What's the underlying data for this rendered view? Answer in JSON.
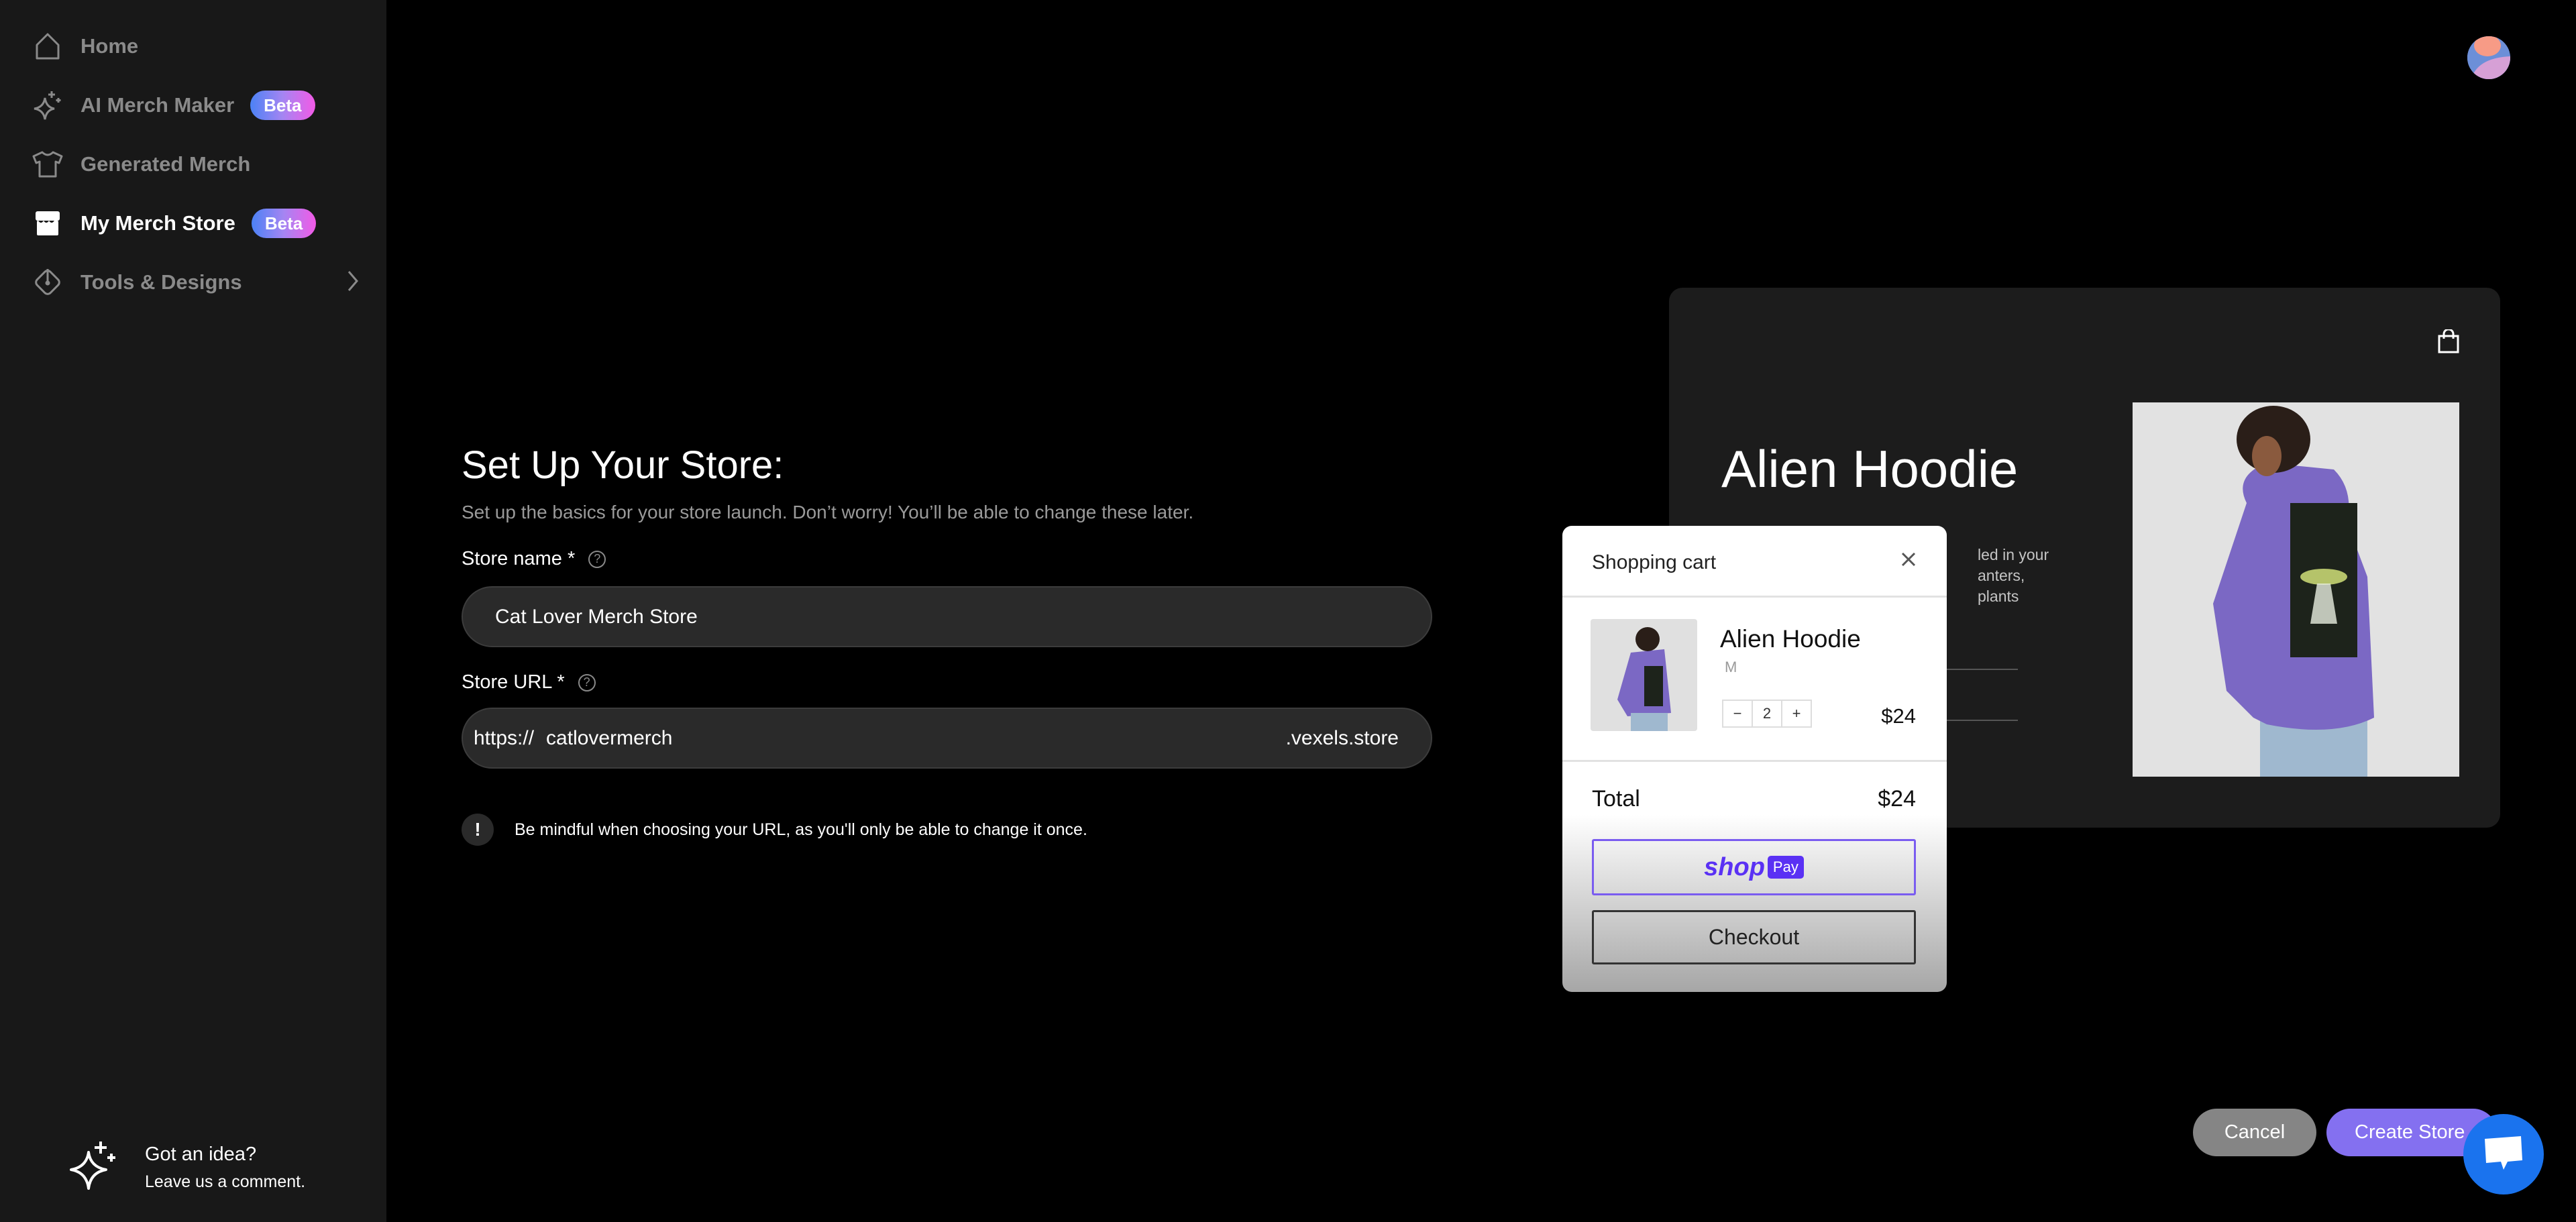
{
  "sidebar": {
    "items": [
      {
        "label": "Home",
        "icon": "home-icon"
      },
      {
        "label": "AI Merch Maker",
        "icon": "sparkle-icon",
        "badge": "Beta"
      },
      {
        "label": "Generated Merch",
        "icon": "tshirt-icon"
      },
      {
        "label": "My Merch Store",
        "icon": "store-icon",
        "badge": "Beta",
        "active": true
      },
      {
        "label": "Tools & Designs",
        "icon": "pen-tool-icon",
        "has_submenu": true
      }
    ],
    "feedback": {
      "title": "Got an idea?",
      "subtitle": "Leave us a comment."
    }
  },
  "form": {
    "title": "Set Up Your Store:",
    "subtitle": "Set up the basics for your store launch. Don’t worry! You’ll be able to change these later.",
    "store_name_label": "Store name *",
    "store_name_value": "Cat Lover Merch Store",
    "store_url_label": "Store URL *",
    "url_prefix": "https://",
    "url_value": "catlovermerch",
    "url_suffix": ".vexels.store",
    "notice_icon": "!",
    "notice": "Be mindful when choosing your URL, as you'll only be able to change it once."
  },
  "preview": {
    "product_title": "Alien Hoodie",
    "description_lines": [
      "led in your",
      "anters,",
      "plants"
    ],
    "cart": {
      "title": "Shopping cart",
      "item_name": "Alien Hoodie",
      "item_variant": "M",
      "quantity": "2",
      "minus": "−",
      "plus": "+",
      "item_price": "$24",
      "total_label": "Total",
      "total_value": "$24",
      "shop_label": "shop",
      "pay_label": "Pay",
      "checkout_label": "Checkout"
    }
  },
  "actions": {
    "cancel": "Cancel",
    "create": "Create Store"
  },
  "colors": {
    "accent": "#8470f0",
    "sidebar_bg": "#181818",
    "chat": "#1a73ee",
    "shop_pay": "#5a31f4"
  }
}
